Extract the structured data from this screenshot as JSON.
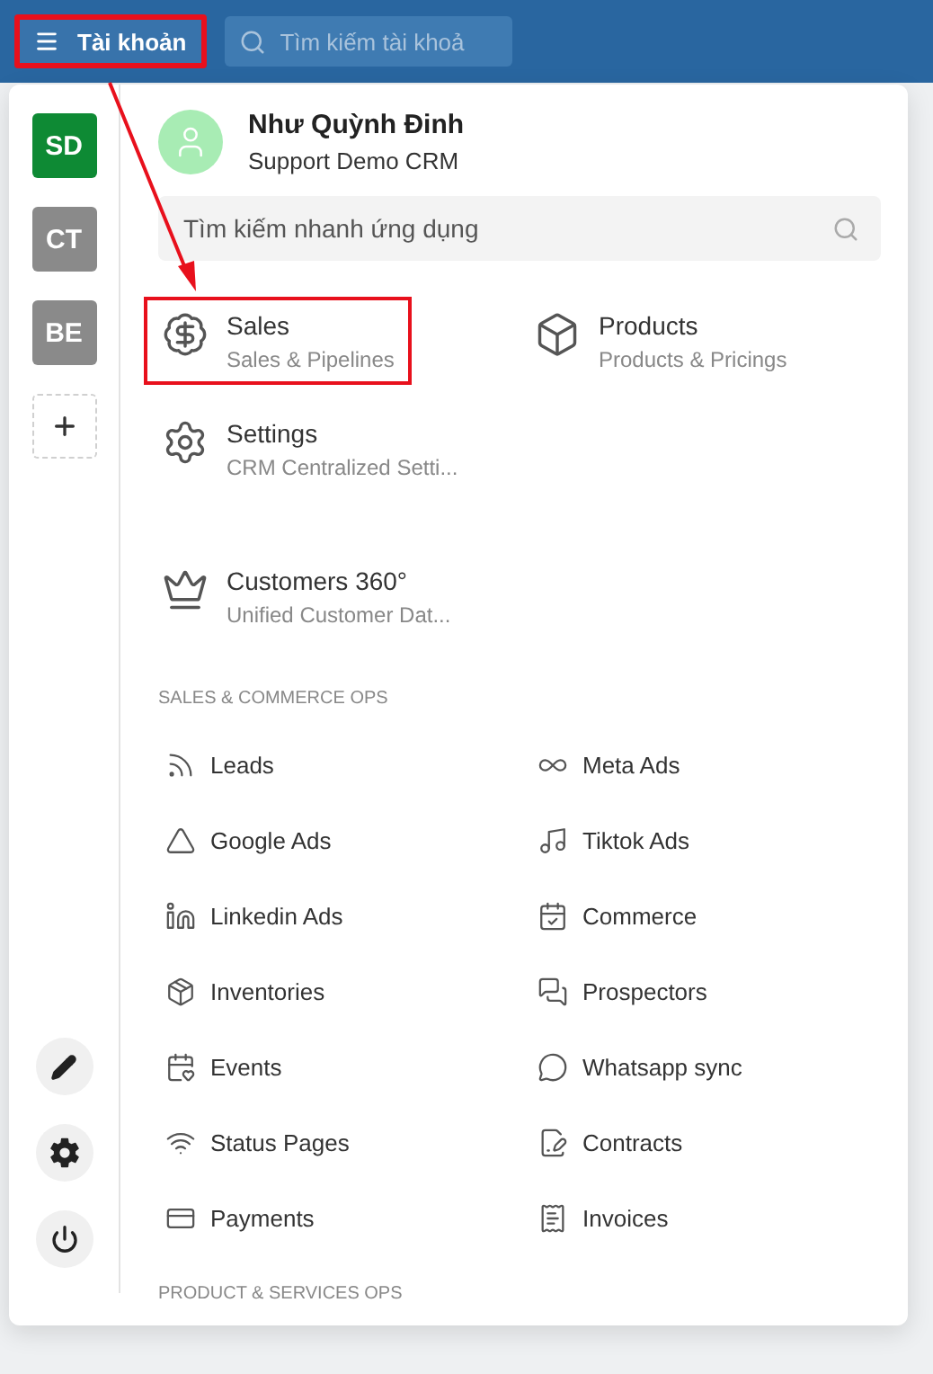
{
  "top_bar": {
    "account_button": {
      "label": "Tài khoản",
      "highlighted": true
    },
    "search": {
      "placeholder": "Tìm kiếm tài khoả"
    }
  },
  "workspaces": [
    {
      "initials": "SD",
      "selected": true
    },
    {
      "initials": "CT",
      "selected": false
    },
    {
      "initials": "BE",
      "selected": false
    }
  ],
  "profile": {
    "name": "Như Quỳnh Đinh",
    "organization": "Support Demo CRM"
  },
  "app_search": {
    "placeholder": "Tìm kiếm nhanh ứng dụng"
  },
  "featured_apps": [
    {
      "title": "Sales",
      "subtitle": "Sales & Pipelines",
      "highlighted": true
    },
    {
      "title": "Products",
      "subtitle": "Products & Pricings",
      "highlighted": false
    },
    {
      "title": "Settings",
      "subtitle": "CRM Centralized Setti...",
      "highlighted": false
    },
    {
      "title": "Customers 360°",
      "subtitle": "Unified Customer Dat...",
      "highlighted": false
    }
  ],
  "sections": [
    {
      "title": "SALES & COMMERCE OPS",
      "apps": [
        "Leads",
        "Meta Ads",
        "Google Ads",
        "Tiktok Ads",
        "Linkedin Ads",
        "Commerce",
        "Inventories",
        "Prospectors",
        "Events",
        "Whatsapp sync",
        "Status Pages",
        "Contracts",
        "Payments",
        "Invoices"
      ]
    },
    {
      "title": "PRODUCT & SERVICES OPS"
    }
  ]
}
